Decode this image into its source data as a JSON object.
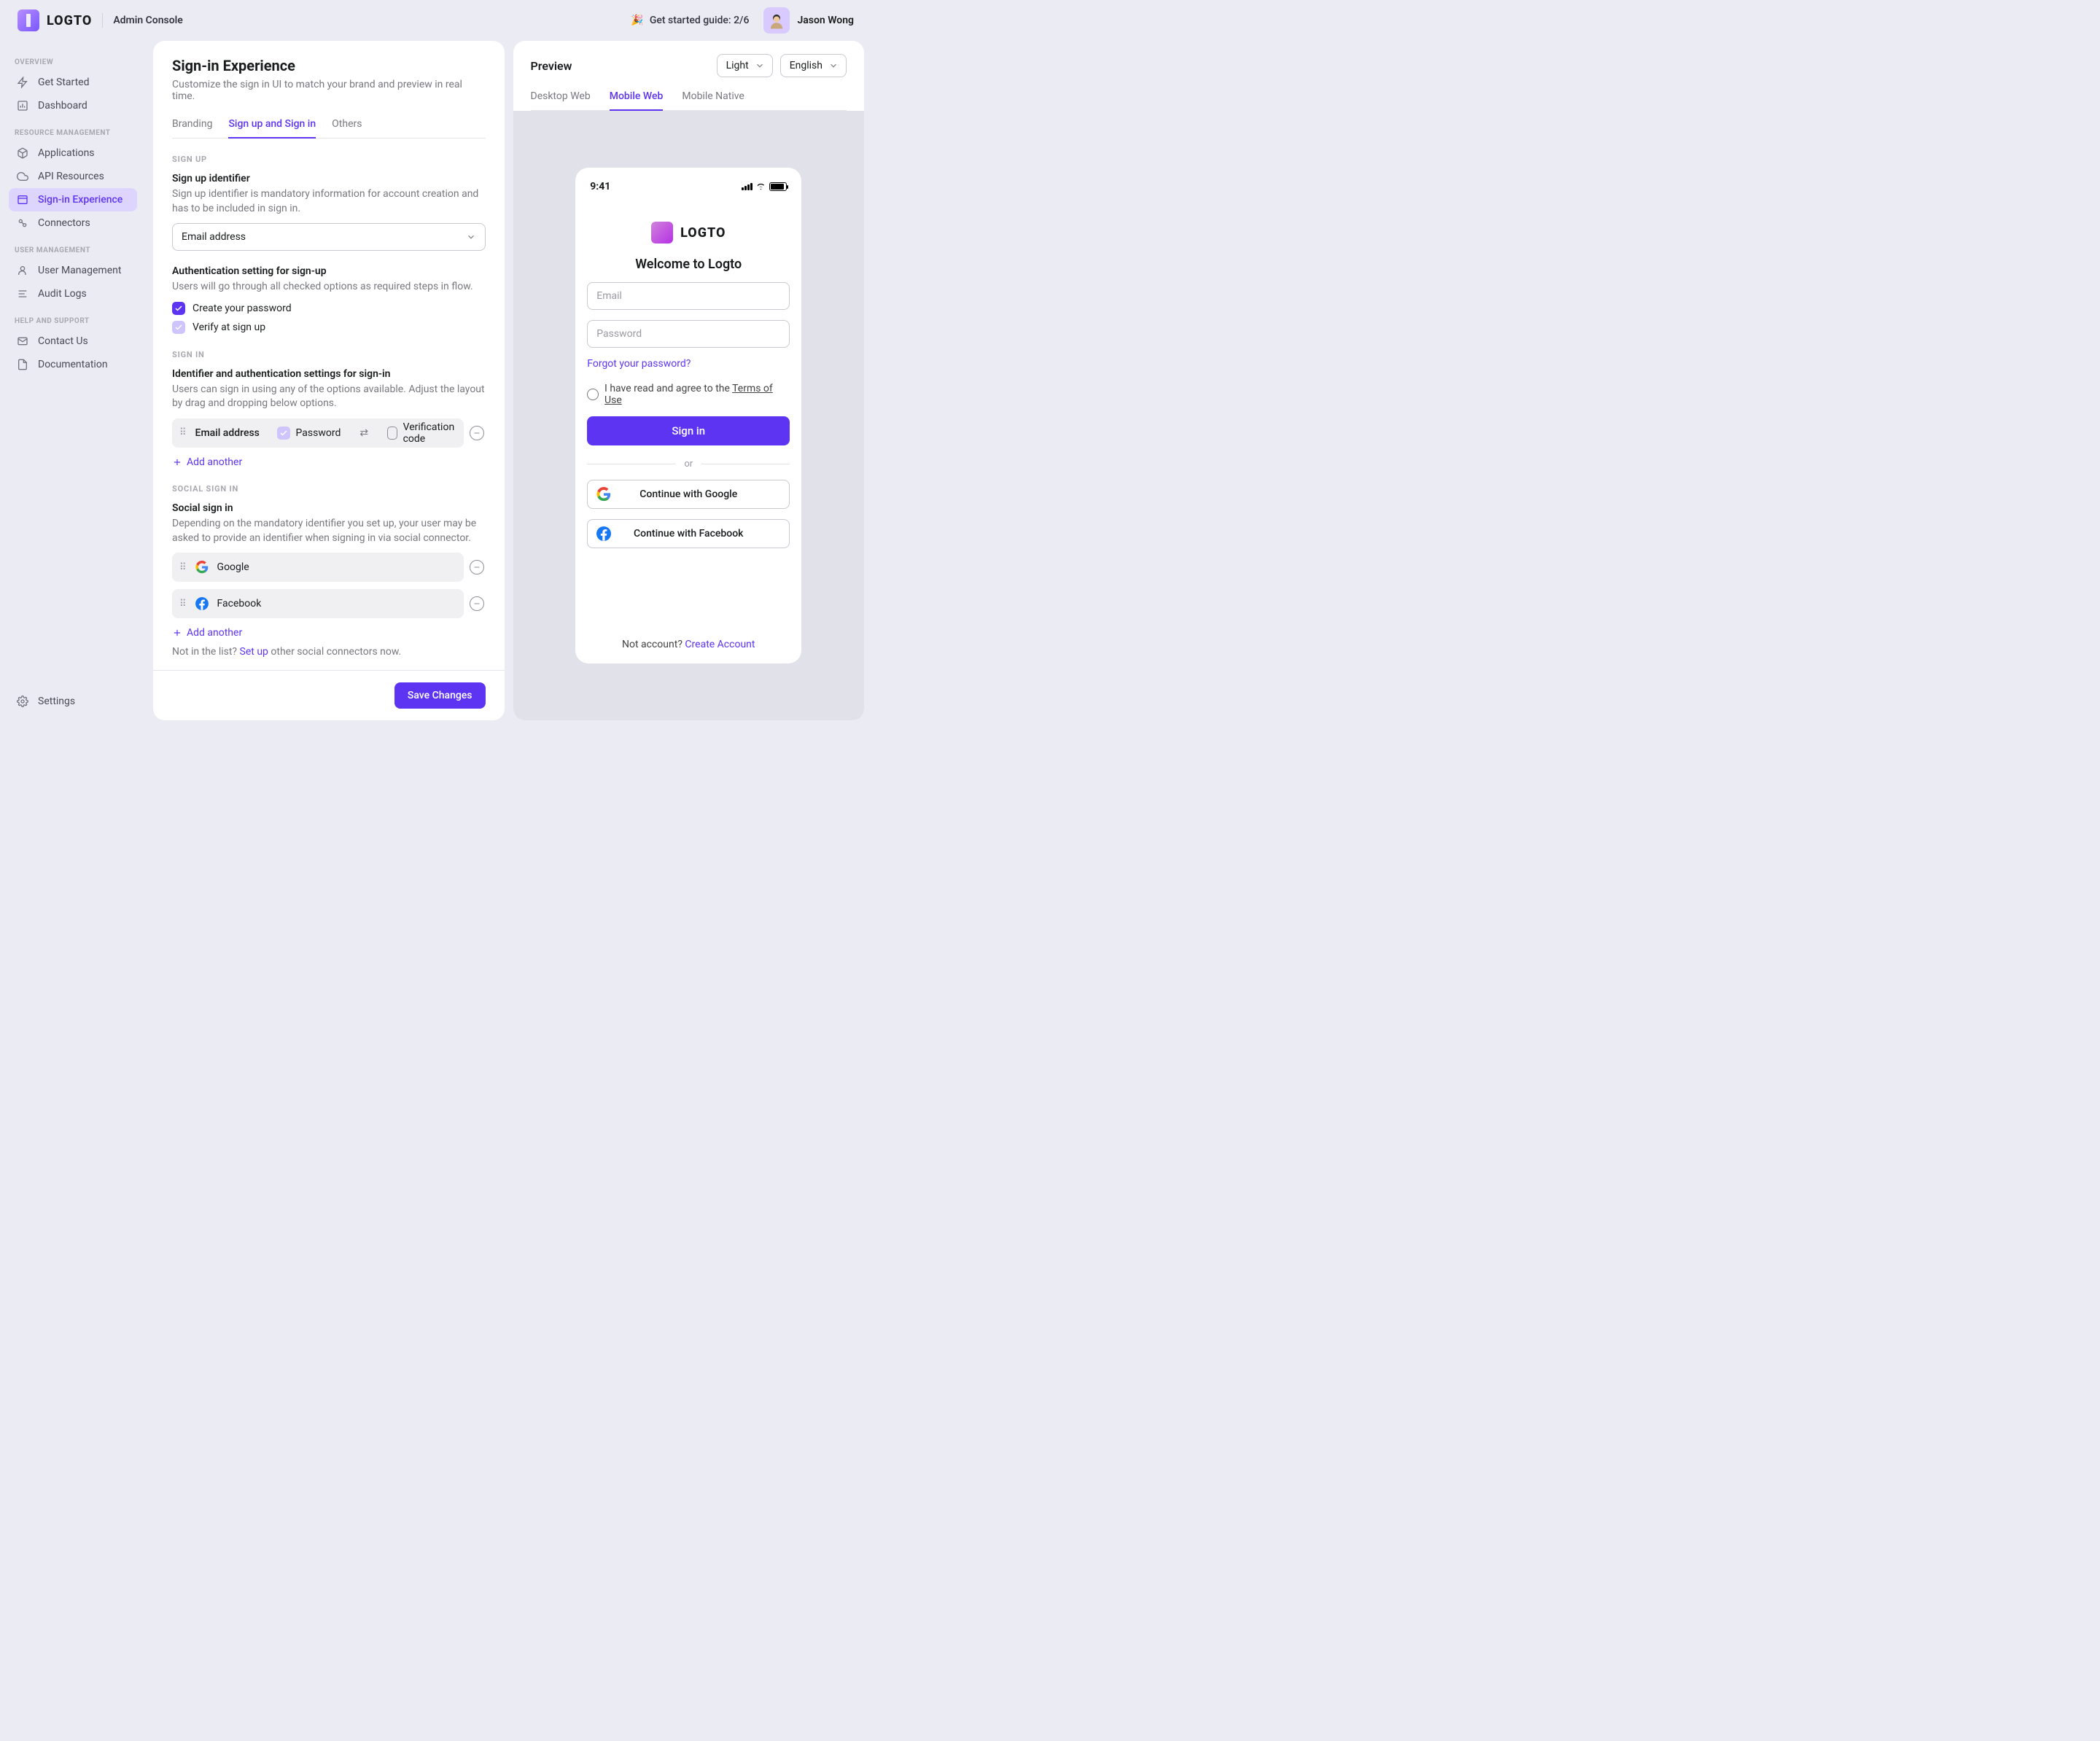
{
  "topbar": {
    "brand": "LOGTO",
    "console": "Admin Console",
    "guide": "Get started guide: 2/6",
    "user": "Jason Wong"
  },
  "sidebar": {
    "groups": [
      {
        "label": "OVERVIEW",
        "items": [
          "Get Started",
          "Dashboard"
        ]
      },
      {
        "label": "RESOURCE MANAGEMENT",
        "items": [
          "Applications",
          "API Resources",
          "Sign-in Experience",
          "Connectors"
        ]
      },
      {
        "label": "USER MANAGEMENT",
        "items": [
          "User Management",
          "Audit Logs"
        ]
      },
      {
        "label": "HELP AND SUPPORT",
        "items": [
          "Contact Us",
          "Documentation"
        ]
      }
    ],
    "settings": "Settings",
    "active": "Sign-in Experience"
  },
  "page": {
    "title": "Sign-in Experience",
    "subtitle": "Customize the sign in UI to match your brand and preview in real time.",
    "tabs": [
      "Branding",
      "Sign up and Sign in",
      "Others"
    ],
    "active_tab": "Sign up and Sign in"
  },
  "signup": {
    "section": "SIGN UP",
    "identifier_title": "Sign up identifier",
    "identifier_desc": "Sign up identifier is mandatory information for account creation and has to be included in sign in.",
    "identifier_value": "Email address",
    "auth_title": "Authentication setting for sign-up",
    "auth_desc": "Users will go through all checked options as required steps in flow.",
    "opt_password": "Create your password",
    "opt_verify": "Verify at sign up"
  },
  "signin": {
    "section": "SIGN IN",
    "title": "Identifier and authentication settings for sign-in",
    "desc": "Users can sign in using any of the options available. Adjust the layout by drag and dropping below options.",
    "row": {
      "identifier": "Email address",
      "password": "Password",
      "code": "Verification code"
    },
    "add": "Add another"
  },
  "social": {
    "section": "SOCIAL SIGN IN",
    "title": "Social sign in",
    "desc": "Depending on the mandatory identifier you set up, your user may be asked to provide an identifier when signing in via social connector.",
    "providers": [
      "Google",
      "Facebook"
    ],
    "add": "Add another",
    "not_in_list": "Not in the list?",
    "setup": "Set up",
    "rest": " other social connectors now."
  },
  "footer": {
    "save": "Save Changes"
  },
  "preview": {
    "title": "Preview",
    "theme": "Light",
    "lang": "English",
    "tabs": [
      "Desktop Web",
      "Mobile Web",
      "Mobile Native"
    ],
    "active": "Mobile Web",
    "time": "9:41",
    "welcome": "Welcome to Logto",
    "email_ph": "Email",
    "password_ph": "Password",
    "forgot": "Forgot your password?",
    "terms_pre": "I have read and agree to the ",
    "terms_link": "Terms of Use",
    "signin": "Sign in",
    "or": "or",
    "google": "Continue with Google",
    "facebook": "Continue with Facebook",
    "foot_pre": "Not account? ",
    "foot_link": "Create Account",
    "brand": "LOGTO"
  }
}
